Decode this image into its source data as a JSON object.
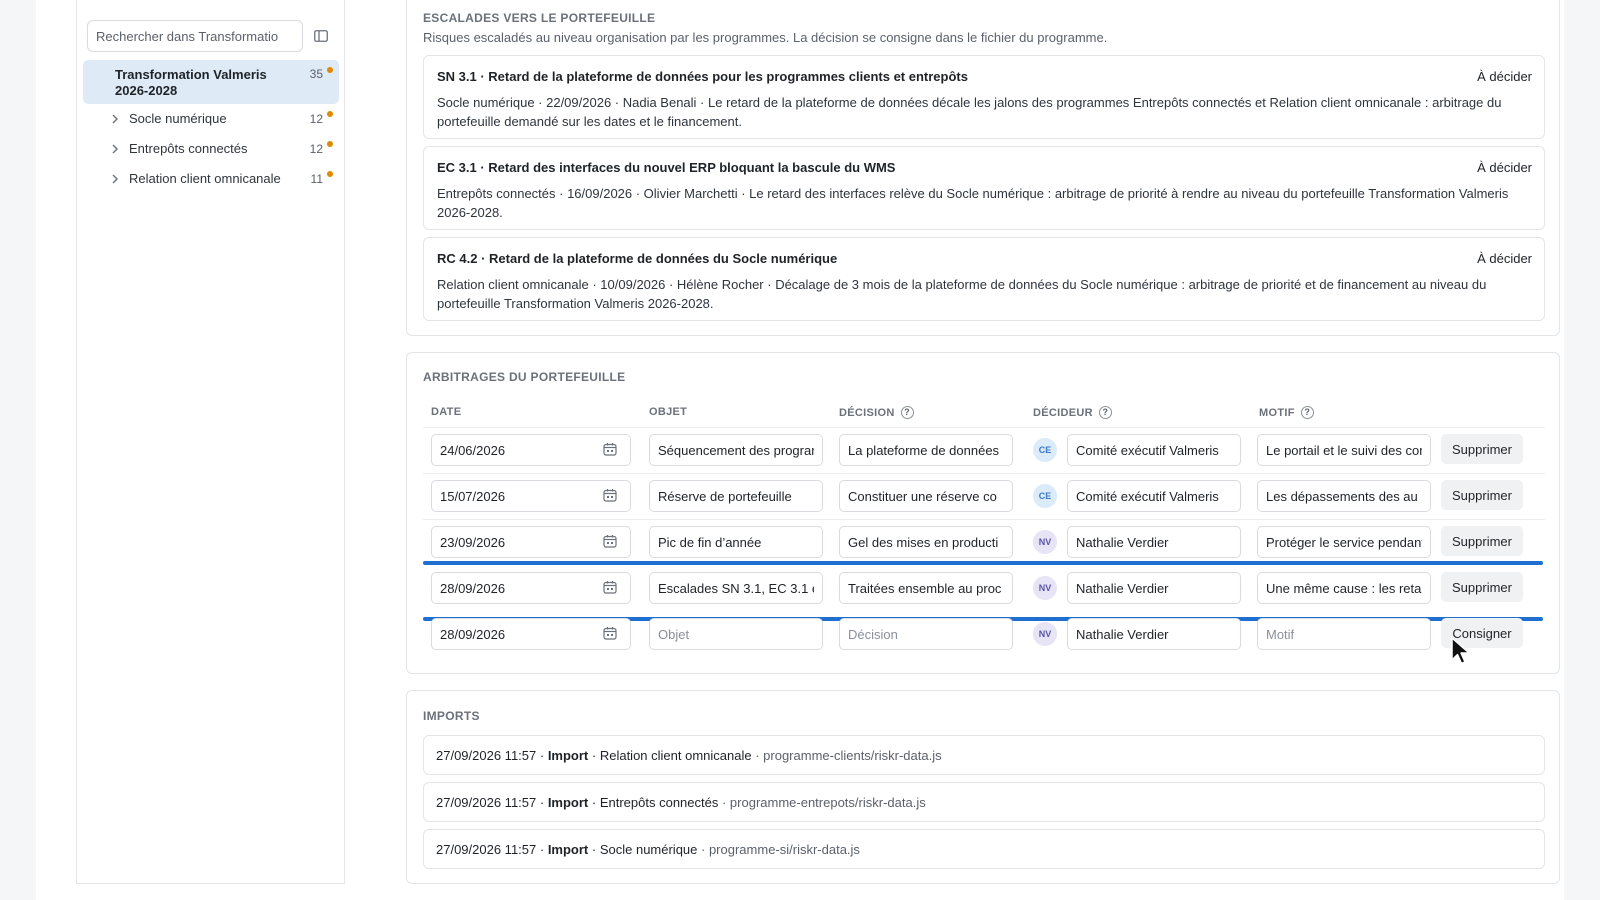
{
  "sidebar": {
    "search_placeholder": "Rechercher dans Transformatio",
    "root": {
      "label": "Transformation Valmeris 2026-2028",
      "count": "35"
    },
    "items": [
      {
        "label": "Socle numérique",
        "count": "12"
      },
      {
        "label": "Entrepôts connectés",
        "count": "12"
      },
      {
        "label": "Relation client omnicanale",
        "count": "11"
      }
    ]
  },
  "escalades": {
    "title": "ESCALADES VERS LE PORTEFEUILLE",
    "description": "Risques escaladés au niveau organisation par les programmes. La décision se consigne dans le fichier du programme.",
    "cards": [
      {
        "head": "SN 3.1 · Retard de la plateforme de données pour les programmes clients et entrepôts",
        "status": "À décider",
        "body": "Socle numérique · 22/09/2026 · Nadia Benali · Le retard de la plateforme de données décale les jalons des programmes Entrepôts connectés et Relation client omnicanale : arbitrage du portefeuille demandé sur les dates et le financement."
      },
      {
        "head": "EC 3.1 · Retard des interfaces du nouvel ERP bloquant la bascule du WMS",
        "status": "À décider",
        "body": "Entrepôts connectés · 16/09/2026 · Olivier Marchetti · Le retard des interfaces relève du Socle numérique : arbitrage de priorité à rendre au niveau du portefeuille Transformation Valmeris 2026-2028."
      },
      {
        "head": "RC 4.2 · Retard de la plateforme de données du Socle numérique",
        "status": "À décider",
        "body": "Relation client omnicanale · 10/09/2026 · Hélène Rocher · Décalage de 3 mois de la plateforme de données du Socle numérique : arbitrage de priorité et de financement au niveau du portefeuille Transformation Valmeris 2026-2028."
      }
    ]
  },
  "arbitrages": {
    "title": "ARBITRAGES DU PORTEFEUILLE",
    "columns": {
      "date": "DATE",
      "objet": "OBJET",
      "decision": "DÉCISION",
      "decideur": "DÉCIDEUR",
      "motif": "MOTIF"
    },
    "help_glyph": "?",
    "rows": [
      {
        "date": "24/06/2026",
        "objet": "Séquencement des programmes",
        "decision": "La plateforme de données",
        "initials": "CE",
        "decideur": "Comité exécutif Valmeris",
        "motif": "Le portail et le suivi des commandes",
        "action": "Supprimer"
      },
      {
        "date": "15/07/2026",
        "objet": "Réserve de portefeuille",
        "decision": "Constituer une réserve co",
        "initials": "CE",
        "decideur": "Comité exécutif Valmeris",
        "motif": "Les dépassements des au",
        "action": "Supprimer"
      },
      {
        "date": "23/09/2026",
        "objet": "Pic de fin d’année",
        "decision": "Gel des mises en producti",
        "initials": "NV",
        "decideur": "Nathalie Verdier",
        "motif": "Protéger le service pendant",
        "action": "Supprimer"
      },
      {
        "date": "28/09/2026",
        "objet": "Escalades SN 3.1, EC 3.1 e",
        "decision": "Traitées ensemble au proc",
        "initials": "NV",
        "decideur": "Nathalie Verdier",
        "motif": "Une même cause : les retards",
        "action": "Supprimer"
      }
    ],
    "new_row": {
      "date": "28/09/2026",
      "objet_placeholder": "Objet",
      "decision_placeholder": "Décision",
      "initials": "NV",
      "decideur": "Nathalie Verdier",
      "motif_placeholder": "Motif",
      "action": "Consigner"
    }
  },
  "imports": {
    "title": "IMPORTS",
    "rows": [
      {
        "timestamp": "27/09/2026 11:57",
        "kw": "Import",
        "program": "Relation client omnicanale",
        "path": "programme-clients/riskr-data.js"
      },
      {
        "timestamp": "27/09/2026 11:57",
        "kw": "Import",
        "program": "Entrepôts connectés",
        "path": "programme-entrepots/riskr-data.js"
      },
      {
        "timestamp": "27/09/2026 11:57",
        "kw": "Import",
        "program": "Socle numérique",
        "path": "programme-si/riskr-data.js"
      }
    ],
    "sep": " · "
  },
  "colors": {
    "accent": "#1f6fd1",
    "selected_bg": "#dfeaf7",
    "dot": "#e08a00"
  },
  "icons": {
    "collapse": "sidebar-collapse-icon",
    "chevron": "chevron-right-icon",
    "calendar": "calendar-icon",
    "cursor": "mouse-pointer-icon"
  }
}
